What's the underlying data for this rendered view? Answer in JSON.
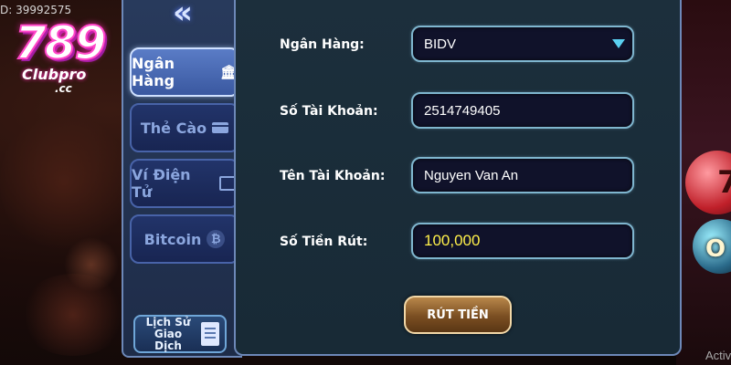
{
  "header": {
    "user_id": "D: 39992575",
    "logo_number": "789",
    "logo_sub": "Clubpro",
    "logo_domain": ".cc"
  },
  "sidebar": {
    "back_icon": "double-chevron-left-icon",
    "tabs": [
      {
        "label": "Ngân Hàng",
        "icon": "bank-icon",
        "active": true
      },
      {
        "label": "Thẻ Cào",
        "icon": "card-icon",
        "active": false
      },
      {
        "label": "Ví Điện Tử",
        "icon": "wallet-icon",
        "active": false
      },
      {
        "label": "Bitcoin",
        "icon": "bitcoin-icon",
        "active": false
      }
    ],
    "history_line1": "Lịch Sử",
    "history_line2": "Giao Dịch",
    "history_icon": "document-icon"
  },
  "form": {
    "bank_label": "Ngân Hàng:",
    "bank_value": "BIDV",
    "account_number_label": "Số Tài Khoản:",
    "account_number_value": "2514749405",
    "account_name_label": "Tên Tài Khoản:",
    "account_name_value": "Nguyen Van An",
    "amount_label": "Số Tiền Rút:",
    "amount_value": "100,000",
    "submit_label": "RÚT TIỀN"
  },
  "background": {
    "ball_number": "7",
    "ball_text": "O",
    "corner_text": "Activ"
  },
  "colors": {
    "panel_bg": "#1c2f3c",
    "field_border": "#7fb6cf",
    "amount_text": "#fff04a",
    "active_tab": "#5a7cc6",
    "button_gold": "#b8874a"
  }
}
